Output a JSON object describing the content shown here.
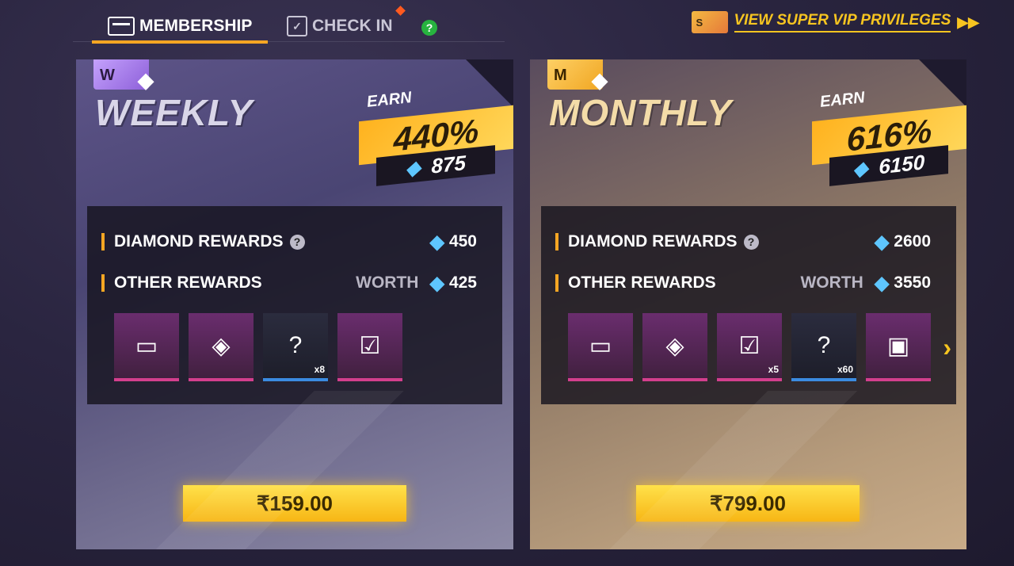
{
  "tabs": {
    "membership": "MEMBERSHIP",
    "check_in": "CHECK IN"
  },
  "vip_link": {
    "card_letter": "S",
    "label": "VIEW SUPER VIP PRIVILEGES"
  },
  "plans": {
    "weekly": {
      "card_letter": "W",
      "title": "WEEKLY",
      "earn_label": "EARN",
      "earn_percent": "440%",
      "earn_diamonds": "875",
      "diamond_rewards_label": "DIAMOND REWARDS",
      "diamond_rewards_amount": "450",
      "other_rewards_label": "OTHER REWARDS",
      "worth_label": "WORTH",
      "other_rewards_amount": "425",
      "items": [
        {
          "icon": "weekly-card-icon",
          "count": ""
        },
        {
          "icon": "voucher-bundle-icon",
          "count": ""
        },
        {
          "icon": "mystery-box-icon",
          "count": "x8"
        },
        {
          "icon": "check-in-card-icon",
          "count": ""
        }
      ],
      "price": "₹159.00"
    },
    "monthly": {
      "card_letter": "M",
      "title": "MONTHLY",
      "earn_label": "EARN",
      "earn_percent": "616%",
      "earn_diamonds": "6150",
      "diamond_rewards_label": "DIAMOND REWARDS",
      "diamond_rewards_amount": "2600",
      "other_rewards_label": "OTHER REWARDS",
      "worth_label": "WORTH",
      "other_rewards_amount": "3550",
      "items": [
        {
          "icon": "monthly-card-icon",
          "count": ""
        },
        {
          "icon": "voucher-bundle-icon",
          "count": ""
        },
        {
          "icon": "check-in-card-icon",
          "count": "x5"
        },
        {
          "icon": "mystery-box-icon",
          "count": "x60"
        },
        {
          "icon": "loot-crate-icon",
          "count": ""
        }
      ],
      "price": "₹799.00"
    }
  },
  "colors": {
    "accent": "#f5a623",
    "button": "#f7c520",
    "diamond": "#5ec6ff"
  }
}
